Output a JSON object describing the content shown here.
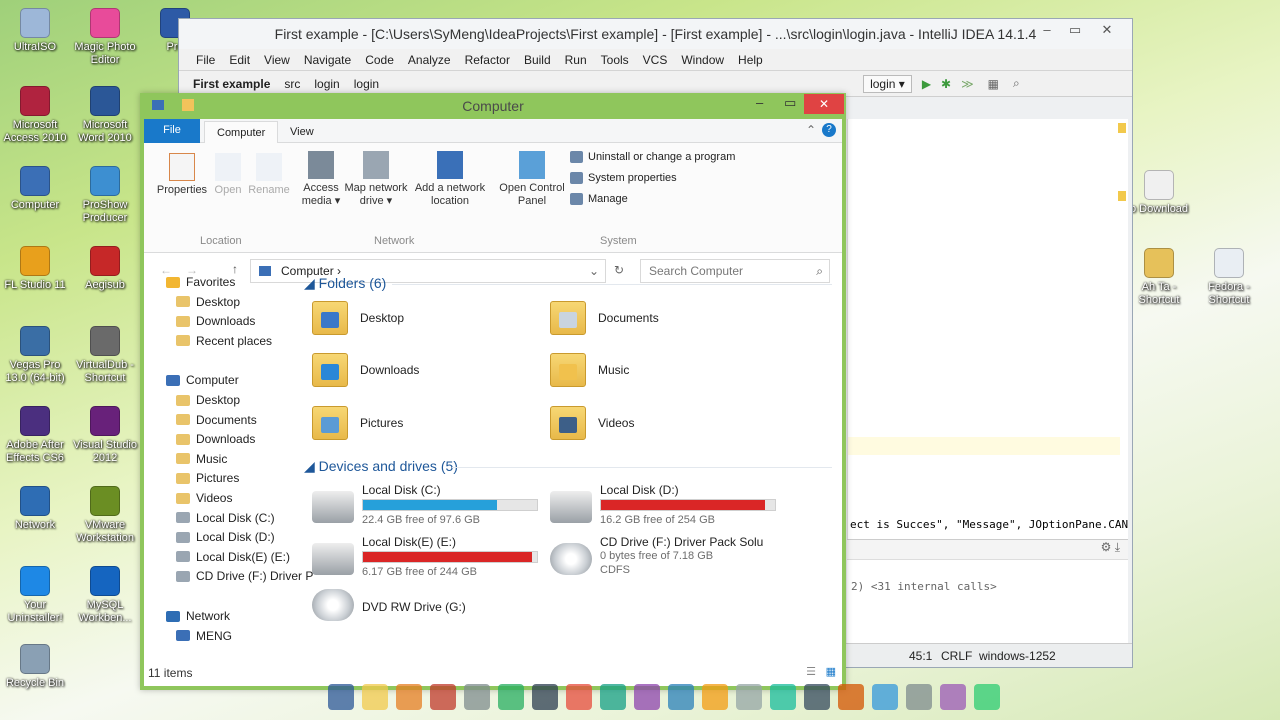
{
  "desktop_icons": [
    {
      "label": "UltraISO",
      "color": "#9db7d8"
    },
    {
      "label": "Magic Photo Editor",
      "color": "#e84b9a"
    },
    {
      "label": "Pro",
      "color": "#2d5aa6"
    },
    {
      "label": "Microsoft Access 2010",
      "color": "#b0233f"
    },
    {
      "label": "Microsoft Word 2010",
      "color": "#2b5797"
    },
    {
      "label": "Computer",
      "color": "#3b6fb6"
    },
    {
      "label": "ProShow Producer",
      "color": "#3d8fd1"
    },
    {
      "label": "FL Studio 11",
      "color": "#e8a01c"
    },
    {
      "label": "Aegisub",
      "color": "#c62828"
    },
    {
      "label": "Vegas Pro 13.0 (64-bit)",
      "color": "#3a6ea5"
    },
    {
      "label": "VirtualDub - Shortcut",
      "color": "#6a6a6a"
    },
    {
      "label": "Adobe After Effects CS6",
      "color": "#4b2f7f"
    },
    {
      "label": "Visual Studio 2012",
      "color": "#68217a"
    },
    {
      "label": "Network",
      "color": "#2e6db4"
    },
    {
      "label": "VMware Workstation",
      "color": "#6b8e23"
    },
    {
      "label": "Your Uninstaller!",
      "color": "#1e88e5"
    },
    {
      "label": "MySQL Workben...",
      "color": "#1565c0"
    },
    {
      "label": "Recycle Bin",
      "color": "#8aa0b4"
    },
    {
      "label": "o Download",
      "color": "#f0f0f0"
    },
    {
      "label": "Ah Ta - Shortcut",
      "color": "#e6c15a"
    },
    {
      "label": "Fedora - Shortcut",
      "color": "#e9eef3"
    }
  ],
  "ide": {
    "title": "First example - [C:\\Users\\SyMeng\\IdeaProjects\\First example] - [First example] - ...\\src\\login\\login.java - IntelliJ IDEA 14.1.4",
    "menus": [
      "File",
      "Edit",
      "View",
      "Navigate",
      "Code",
      "Analyze",
      "Refactor",
      "Build",
      "Run",
      "Tools",
      "VCS",
      "Window",
      "Help"
    ],
    "breadcrumbs": [
      "First example",
      "src",
      "login",
      "login"
    ],
    "run_config": "login",
    "code_line": "ect is Succes\", \"Message\", JOptionPane.CAN",
    "console_line": "2) <31 internal calls>",
    "status": {
      "position": "45:1",
      "line_sep": "CRLF",
      "encoding": "windows-1252"
    }
  },
  "explorer": {
    "title": "Computer",
    "tabs": [
      "File",
      "Computer",
      "View"
    ],
    "ribbon": {
      "location": {
        "label": "Location",
        "buttons": [
          "Properties",
          "Open",
          "Rename"
        ]
      },
      "network": {
        "label": "Network",
        "buttons": [
          "Access media",
          "Map network drive",
          "Add a network location"
        ]
      },
      "system": {
        "label": "System",
        "big": "Open Control Panel",
        "small": [
          "Uninstall or change a program",
          "System properties",
          "Manage"
        ]
      }
    },
    "address": "Computer",
    "search_placeholder": "Search Computer",
    "nav": {
      "favorites": "Favorites",
      "favorites_items": [
        "Desktop",
        "Downloads",
        "Recent places"
      ],
      "computer": "Computer",
      "computer_items": [
        "Desktop",
        "Documents",
        "Downloads",
        "Music",
        "Pictures",
        "Videos",
        "Local Disk (C:)",
        "Local Disk (D:)",
        "Local Disk(E) (E:)",
        "CD Drive (F:) Driver P"
      ],
      "network": "Network",
      "network_items": [
        "MENG"
      ]
    },
    "folders_header": "Folders (6)",
    "folders": [
      "Desktop",
      "Documents",
      "Downloads",
      "Music",
      "Pictures",
      "Videos"
    ],
    "devices_header": "Devices and drives (5)",
    "drives": [
      {
        "name": "Local Disk (C:)",
        "free": "22.4 GB free of 97.6 GB",
        "used_fraction": 0.77,
        "color": "#26a0da"
      },
      {
        "name": "Local Disk (D:)",
        "free": "16.2 GB free of 254 GB",
        "used_fraction": 0.94,
        "color": "#da2626"
      },
      {
        "name": "Local Disk(E) (E:)",
        "free": "6.17 GB free of 244 GB",
        "used_fraction": 0.97,
        "color": "#da2626"
      },
      {
        "name": "CD Drive (F:) Driver Pack Solu",
        "free": "0 bytes free of 7.18 GB",
        "fs": "CDFS"
      },
      {
        "name": "DVD RW Drive (G:)"
      }
    ],
    "status": "11 items"
  }
}
